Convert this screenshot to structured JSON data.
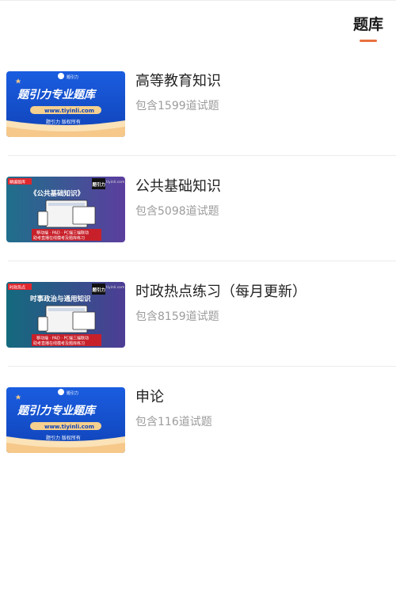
{
  "header": {
    "tab_label": "题库",
    "accent_color": "#e8703e"
  },
  "items": [
    {
      "title": "高等教育知识",
      "subtitle": "包含1599道试题",
      "thumb": {
        "style": "blue",
        "logo_text": "题引力",
        "headline": "题引力专业题库",
        "url_text": "www.tiyinli.com",
        "footer_text": "题引力 版权所有"
      }
    },
    {
      "title": "公共基础知识",
      "subtitle": "包含5098道试题",
      "thumb": {
        "style": "purple",
        "tag_text": "精编题库",
        "brand_text": "题引力",
        "site_text": "tiyinli.com",
        "headline": "《公共基础知识》",
        "line1": "移动端 · PAD · PC端三端联动",
        "line2": "助考直播在线模考及题库练习"
      }
    },
    {
      "title": "时政热点练习（每月更新）",
      "subtitle": "包含8159道试题",
      "thumb": {
        "style": "teal",
        "tag_text": "时政热点",
        "brand_text": "题引力",
        "site_text": "tiyinli.com",
        "headline": "时事政治与通用知识",
        "line1": "移动端 · PAD · PC端三端联动",
        "line2": "助考直播在线模考及题库练习"
      }
    },
    {
      "title": "申论",
      "subtitle": "包含116道试题",
      "thumb": {
        "style": "blue",
        "logo_text": "题引力",
        "headline": "题引力专业题库",
        "url_text": "www.tiyinli.com",
        "footer_text": "题引力 版权所有"
      }
    }
  ]
}
